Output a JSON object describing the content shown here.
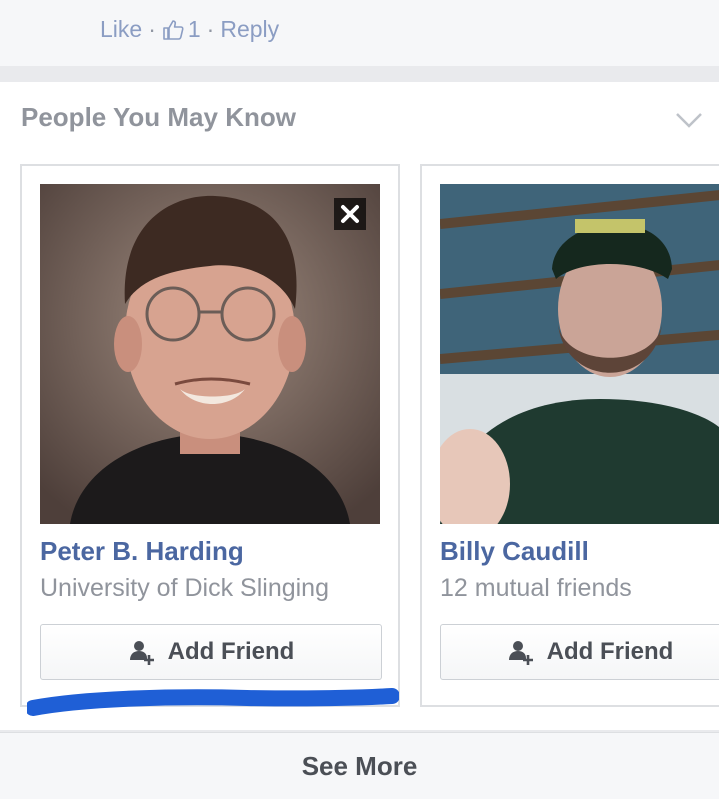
{
  "comment": {
    "like_label": "Like",
    "separator": "·",
    "like_count": "1",
    "reply_label": "Reply"
  },
  "pymk": {
    "title": "People You May Know",
    "people": [
      {
        "name": "Peter B. Harding",
        "subtitle": "University of Dick Slinging",
        "button_label": "Add Friend"
      },
      {
        "name": "Billy Caudill",
        "subtitle": "12 mutual friends",
        "button_label": "Add Friend"
      }
    ],
    "see_more_label": "See More"
  },
  "colors": {
    "link_blue": "#4b67a1",
    "muted_gray": "#90949c",
    "marker_blue": "#1f5fd6"
  },
  "icons": [
    "like-thumb-icon",
    "chevron-down-icon",
    "close-icon",
    "add-friend-icon"
  ]
}
